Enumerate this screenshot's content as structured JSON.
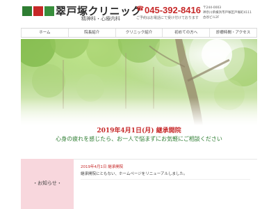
{
  "header": {
    "clinic_name": "翠戸塚クリニック",
    "departments": "精神科・心療内科",
    "phone_number": "045-392-8416",
    "phone_note": "ご予約はお電話にて受け付けております",
    "postal": "〒244-0003",
    "address_line1": "神奈川県横浜市戸塚区戸塚町4111",
    "address_line2": "古谷ビル2F"
  },
  "nav": {
    "items": [
      {
        "label": "ホーム"
      },
      {
        "label": "院長紹介"
      },
      {
        "label": "クリニック紹介"
      },
      {
        "label": "初めての方へ"
      },
      {
        "label": "診療時間・アクセス"
      }
    ]
  },
  "hero": {
    "headline": "2019年4月1日(月) 継承開院",
    "tagline": "心身の疲れを感じたら、お一人で悩まずにお気軽にご相談ください"
  },
  "news": {
    "label": "・お知らせ・",
    "entry_date": "2019年4月1日 継承開院",
    "entry_body": "継承開院にともない、ホームページをリニューアルしました。"
  },
  "colors": {
    "accent_red": "#c62828",
    "accent_green": "#2e7d32",
    "news_pink": "#f8d7dd"
  }
}
